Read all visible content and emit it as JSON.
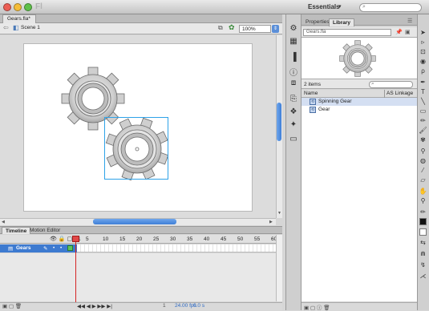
{
  "app": {
    "logo_text": "Fl",
    "workspace": "Essentials",
    "window_buttons": [
      "close",
      "minimize",
      "zoom"
    ],
    "search_icon": "search-icon"
  },
  "document": {
    "tab_label": "Gears.fla*",
    "scene_label": "Scene 1",
    "zoom": "100%"
  },
  "stage": {
    "background_color": "#ffffff",
    "objects": [
      "Gear",
      "Spinning Gear"
    ],
    "selected_object": "Spinning Gear"
  },
  "timeline": {
    "tabs": [
      "Timeline",
      "Motion Editor"
    ],
    "active_tab": "Timeline",
    "layer": {
      "name": "Gears"
    },
    "ruler": [
      "1",
      "5",
      "10",
      "15",
      "20",
      "25",
      "30",
      "35",
      "40",
      "45",
      "50",
      "55",
      "60"
    ],
    "current_frame": "1",
    "fps": "24.00 fps",
    "time": "0.0 s",
    "controls": "◀◀ ◀ ▶ ▶▶ ▶|"
  },
  "library": {
    "tabs": [
      "Properties",
      "Library"
    ],
    "active_tab": "Library",
    "document_name": "Gears.fla",
    "item_count": "2 items",
    "columns": [
      "Name",
      "AS Linkage"
    ],
    "items": [
      {
        "name": "Spinning Gear",
        "selected": true
      },
      {
        "name": "Gear",
        "selected": false
      }
    ]
  },
  "colors": {
    "selection": "#2ea2e8",
    "playhead": "#d42424",
    "accent": "#3d7ad0"
  }
}
